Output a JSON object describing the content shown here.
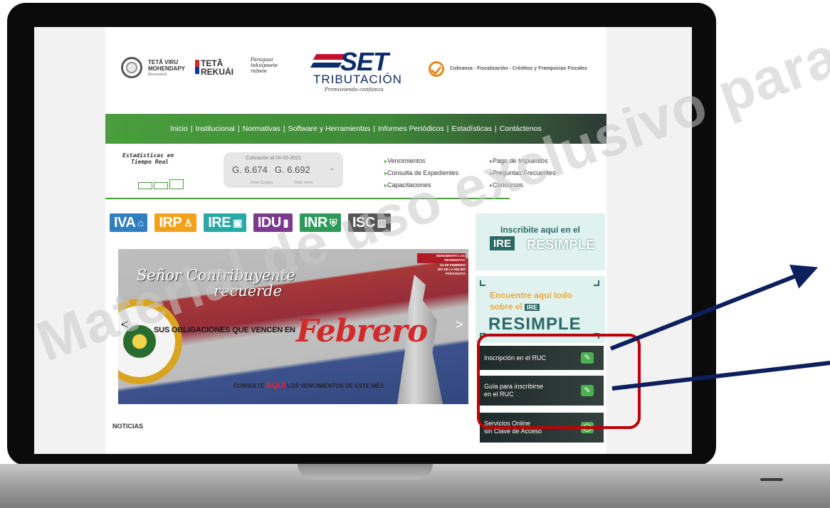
{
  "header": {
    "teta_viru": "TETÃ VIRU MOHENDAPY",
    "teta_viru_sub": "Monouslorã",
    "teta_rekuai": "TETÃ REKUÁI",
    "paraguai": "Paraguai tekuipuete rubeie",
    "set_logo": "SET",
    "tributacion": "TRIBUTACIÓN",
    "promo": "Promoviendo confianza",
    "cobranza": "Cobranza - Fiscalización - Créditos y Franquicias Fiscales"
  },
  "nav": {
    "items": [
      "Inicio",
      "Institucional",
      "Normativas",
      "Software y Herramientas",
      "Informes Periódicos",
      "Estadísticas",
      "Contáctenos"
    ],
    "separator": "|"
  },
  "stats": {
    "title_line1": "Estadísticas en",
    "title_line2": "Tiempo Real"
  },
  "cotizacion": {
    "title": "Cotización al 04-05-2021",
    "compra": "G. 6.674",
    "venta": "G. 6.692",
    "compra_label": "Dolar Compra",
    "venta_label": "Dolar Venta"
  },
  "quick_links": {
    "col1": [
      "Vencimientos",
      "Consulta de Expedientes",
      "Capacitaciones"
    ],
    "col2": [
      "Pago de Impuestos",
      "Preguntas Frecuentes",
      "Concursos"
    ]
  },
  "taxes": [
    {
      "label": "IVA",
      "icon": "house-icon",
      "color": "#2f7fc1"
    },
    {
      "label": "IRP",
      "icon": "people-icon",
      "color": "#f2a21a"
    },
    {
      "label": "IRE",
      "icon": "briefcase-icon",
      "color": "#2aa8a6"
    },
    {
      "label": "IDU",
      "icon": "bars-icon",
      "color": "#7a3b8f"
    },
    {
      "label": "INR",
      "icon": "shield-icon",
      "color": "#2d9a58"
    },
    {
      "label": "ISC",
      "icon": "barcode-icon",
      "color": "#555555"
    }
  ],
  "banner": {
    "title_line1": "Señor Contribuyente",
    "title_line2": "recuerde",
    "main_text": "SUS OBLIGACIONES QUE VENCEN EN",
    "month": "Febrero",
    "consulte": "CONSULTE",
    "aqui": "AQUÍ",
    "sub_rest": "LOS VENCIMIENTOS DE ESTE MES",
    "monumento": "MONUMENTO LAS RESIDENTAS",
    "fecha": "24 DE FEBRERO",
    "dia": "DÍA DE LA MUJER PARAGUAYA",
    "prev": "<",
    "next": ">"
  },
  "sidebar": {
    "inscribite": "Inscribite aquí en el",
    "ire": "IRE",
    "resimple": "RESIMPLE",
    "encuentre_l1": "Encuentre aquí todo",
    "encuentre_l2": "sobre el",
    "btn_inscripcion": "Inscripción en el RUC",
    "btn_guia_l1": "Guía para inscribirse",
    "btn_guia_l2": "en el RUC",
    "btn_servicios_l1": "Servicios Online",
    "btn_servicios_l2": "sin Clave de Acceso"
  },
  "noticias": "NOTICIAS",
  "watermark": "Material de uso exclusivo para cap",
  "annotation": {
    "highlight_color": "#c00000",
    "arrow_color": "#0d1f5c"
  }
}
